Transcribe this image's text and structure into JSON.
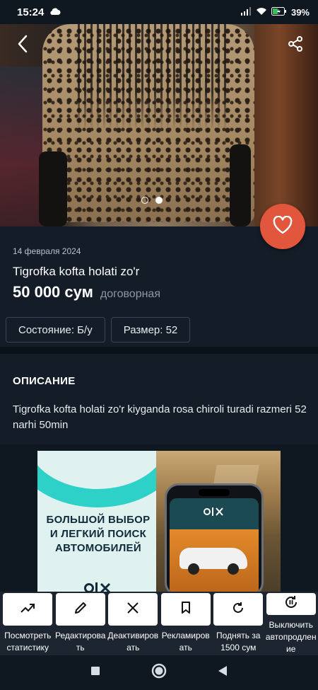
{
  "status_bar": {
    "time": "15:24",
    "battery": "39%"
  },
  "listing": {
    "date": "14 февраля 2024",
    "title": "Tigrofka kofta holati zo'r",
    "price": "50 000 сум",
    "negotiable": "договорная",
    "attributes": [
      "Состояние: Б/у",
      "Размер: 52"
    ],
    "image_count": 2,
    "active_image": 1
  },
  "description": {
    "heading": "ОПИСАНИЕ",
    "text": "Tigrofka kofta holati zo'r kiyganda rosa chiroli turadi razmeri 52 narhi 50min"
  },
  "ad": {
    "text": "БОЛЬШОЙ ВЫБОР И ЛЕГКИЙ ПОИСК АВТОМОБИЛЕЙ",
    "logo": "OLX"
  },
  "actions": [
    {
      "label": "Посмотреть статистику",
      "icon": "trend-up-icon"
    },
    {
      "label": "Редактировать",
      "icon": "pencil-icon"
    },
    {
      "label": "Деактивировать",
      "icon": "close-icon"
    },
    {
      "label": "Рекламировать",
      "icon": "bookmark-icon"
    },
    {
      "label": "Поднять за 1500 сум",
      "icon": "refresh-icon"
    },
    {
      "label": "Выключить автопродление",
      "icon": "auto-renew-icon"
    }
  ],
  "colors": {
    "accent": "#e2563e",
    "card": "#131c27",
    "background": "#0f1720"
  }
}
